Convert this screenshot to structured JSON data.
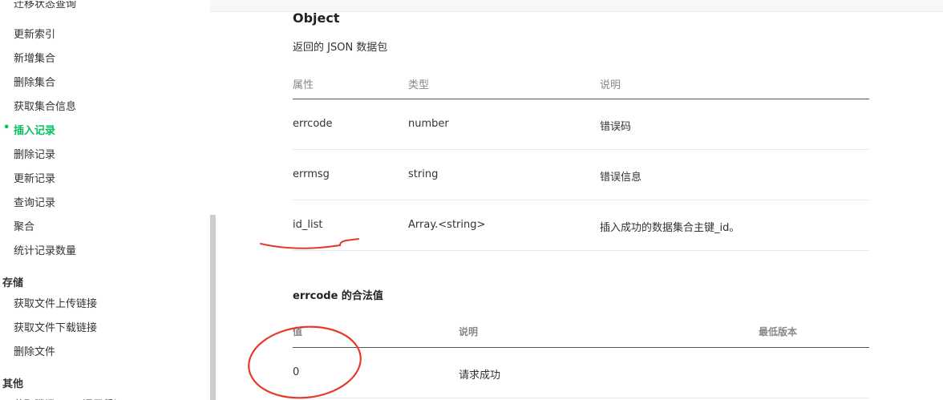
{
  "sidebar": {
    "items": [
      {
        "label": "迁移状态查询",
        "active": false
      },
      {
        "label": "更新索引",
        "active": false
      },
      {
        "label": "新增集合",
        "active": false
      },
      {
        "label": "删除集合",
        "active": false
      },
      {
        "label": "获取集合信息",
        "active": false
      },
      {
        "label": "插入记录",
        "active": true
      },
      {
        "label": "删除记录",
        "active": false
      },
      {
        "label": "更新记录",
        "active": false
      },
      {
        "label": "查询记录",
        "active": false
      },
      {
        "label": "聚合",
        "active": false
      },
      {
        "label": "统计记录数量",
        "active": false
      }
    ],
    "sections": [
      {
        "title": "存储",
        "items": [
          "获取文件上传链接",
          "获取文件下载链接",
          "删除文件"
        ]
      },
      {
        "title": "其他",
        "items": [
          "获取腾讯云API调用凭证"
        ]
      }
    ],
    "active_color": "#07c160"
  },
  "main": {
    "title": "Object",
    "description": "返回的 JSON 数据包",
    "table": {
      "headers": [
        "属性",
        "类型",
        "说明"
      ],
      "rows": [
        [
          "errcode",
          "number",
          "错误码"
        ],
        [
          "errmsg",
          "string",
          "错误信息"
        ],
        [
          "id_list",
          "Array.<string>",
          "插入成功的数据集合主键_id。"
        ]
      ]
    },
    "errcode_title": "errcode 的合法值",
    "errcode_table": {
      "headers": [
        "值",
        "说明",
        "最低版本"
      ],
      "rows": [
        [
          "0",
          "请求成功",
          ""
        ]
      ]
    }
  },
  "annotation_color": "#e53a2a"
}
